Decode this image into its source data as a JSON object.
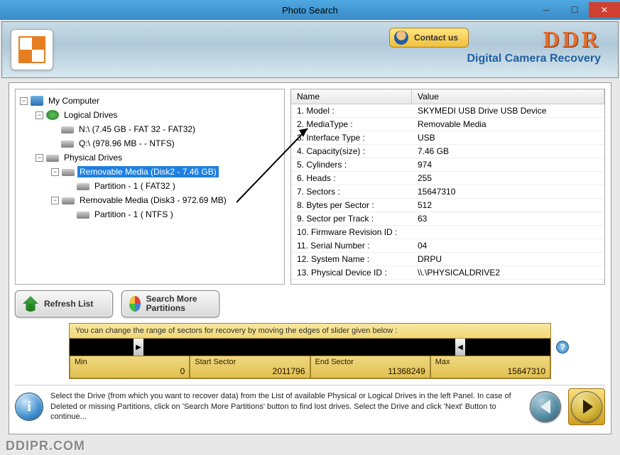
{
  "window": {
    "title": "Photo Search"
  },
  "header": {
    "contact_label": "Contact us",
    "brand": "DDR",
    "brand_sub": "Digital Camera Recovery"
  },
  "tree": {
    "root": "My Computer",
    "logical_label": "Logical Drives",
    "logical": [
      "N:\\ (7.45 GB - FAT 32 - FAT32)",
      "Q:\\ (978.96 MB -  - NTFS)"
    ],
    "physical_label": "Physical Drives",
    "phys1": {
      "label": "Removable Media (Disk2 - 7.46 GB)",
      "partition": "Partition - 1 ( FAT32 )"
    },
    "phys2": {
      "label": "Removable Media (Disk3 - 972.69 MB)",
      "partition": "Partition - 1 ( NTFS )"
    }
  },
  "props": {
    "header_name": "Name",
    "header_value": "Value",
    "rows": [
      {
        "name": "1. Model :",
        "value": "SKYMEDI USB Drive USB Device"
      },
      {
        "name": "2. MediaType :",
        "value": "Removable Media"
      },
      {
        "name": "3. Interface Type :",
        "value": "USB"
      },
      {
        "name": "4. Capacity(size) :",
        "value": "7.46 GB"
      },
      {
        "name": "5. Cylinders :",
        "value": "974"
      },
      {
        "name": "6. Heads :",
        "value": "255"
      },
      {
        "name": "7. Sectors :",
        "value": "15647310"
      },
      {
        "name": "8. Bytes per Sector :",
        "value": "512"
      },
      {
        "name": "9. Sector per Track :",
        "value": "63"
      },
      {
        "name": "10. Firmware Revision ID :",
        "value": ""
      },
      {
        "name": "11. Serial Number :",
        "value": "04"
      },
      {
        "name": "12. System Name :",
        "value": "DRPU"
      },
      {
        "name": "13. Physical Device ID :",
        "value": "\\\\.\\PHYSICALDRIVE2"
      }
    ]
  },
  "buttons": {
    "refresh": "Refresh List",
    "search_more": "Search More Partitions"
  },
  "range": {
    "hint": "You can change the range of sectors for recovery by moving the edges of slider given below :",
    "min_label": "Min",
    "min_value": "0",
    "start_label": "Start Sector",
    "start_value": "2011796",
    "end_label": "End Sector",
    "end_value": "11368249",
    "max_label": "Max",
    "max_value": "15647310"
  },
  "footer": {
    "text": "Select the Drive (from which you want to recover data) from the List of available Physical or Logical Drives in the left Panel. In case of Deleted or missing Partitions, click on 'Search More Partitions' button to find lost drives. Select the Drive and click 'Next' Button to continue..."
  },
  "watermark": "DDIPR.COM"
}
